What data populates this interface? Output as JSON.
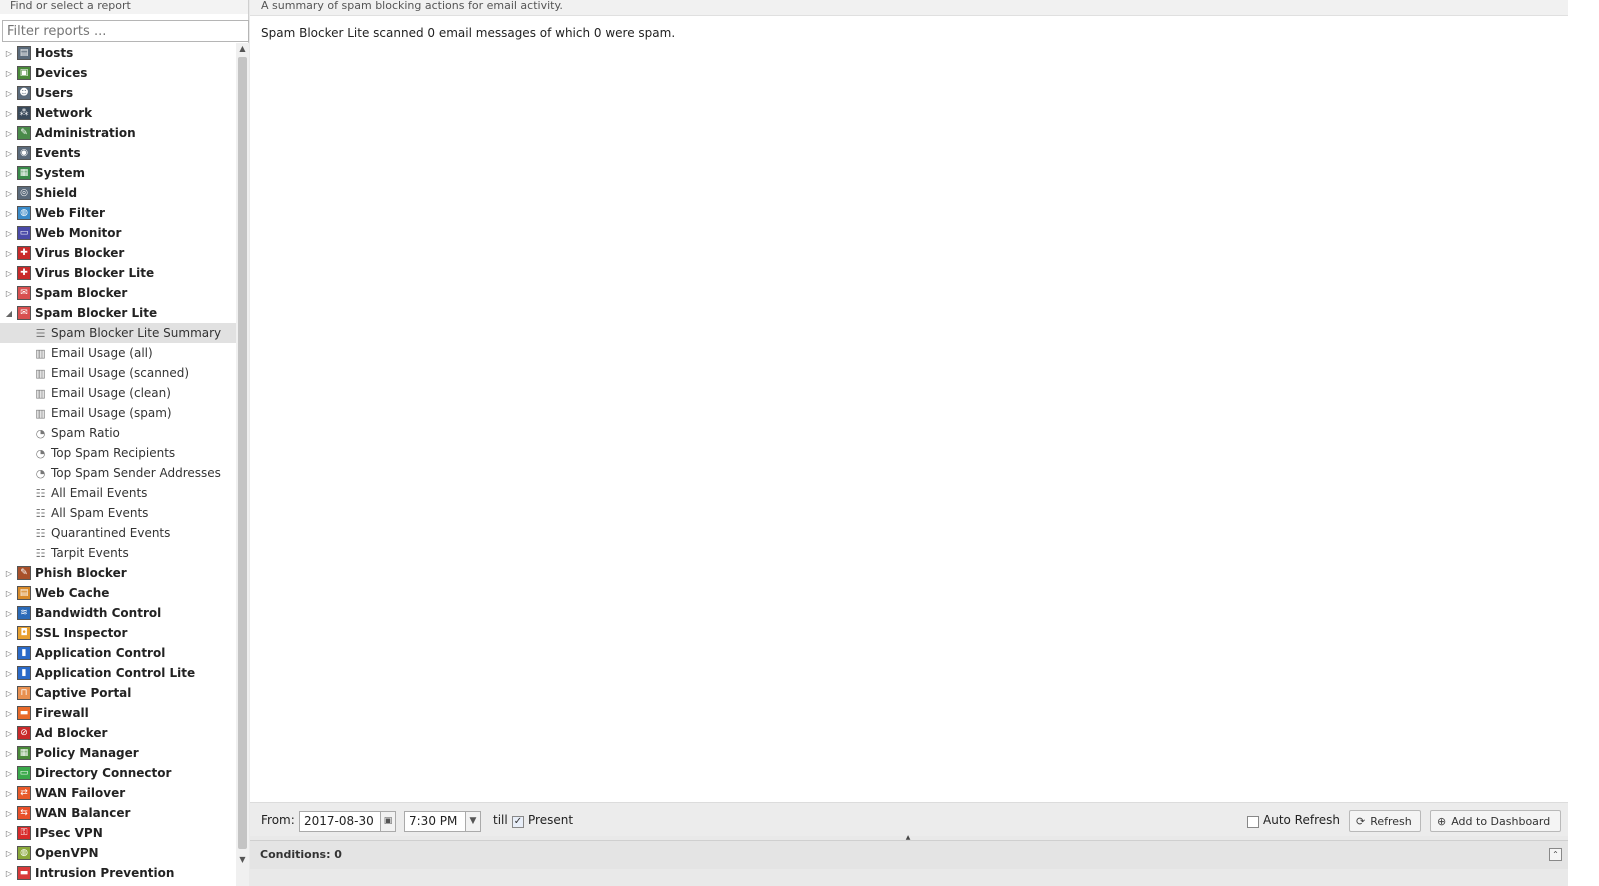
{
  "left": {
    "header": "Find or select a report",
    "filter_placeholder": "Filter reports ...",
    "categories": [
      {
        "label": "Hosts",
        "icon": "hosts-icon",
        "color": "#5a6a7a",
        "glyph": "▤"
      },
      {
        "label": "Devices",
        "icon": "devices-icon",
        "color": "#4a8a3a",
        "glyph": "▣"
      },
      {
        "label": "Users",
        "icon": "users-icon",
        "color": "#5a6a7a",
        "glyph": "☻"
      },
      {
        "label": "Network",
        "icon": "network-icon",
        "color": "#3a4a5a",
        "glyph": "⁂"
      },
      {
        "label": "Administration",
        "icon": "administration-icon",
        "color": "#4a8a4a",
        "glyph": "✎"
      },
      {
        "label": "Events",
        "icon": "events-icon",
        "color": "#5a6a7a",
        "glyph": "◉"
      },
      {
        "label": "System",
        "icon": "system-icon",
        "color": "#3a8a4a",
        "glyph": "▦"
      },
      {
        "label": "Shield",
        "icon": "shield-icon",
        "color": "#5a6a7a",
        "glyph": "◎"
      },
      {
        "label": "Web Filter",
        "icon": "web-filter-icon",
        "color": "#3a8ac8",
        "glyph": "◍"
      },
      {
        "label": "Web Monitor",
        "icon": "web-monitor-icon",
        "color": "#4a4aa8",
        "glyph": "▭"
      },
      {
        "label": "Virus Blocker",
        "icon": "virus-blocker-icon",
        "color": "#c82a2a",
        "glyph": "✚"
      },
      {
        "label": "Virus Blocker Lite",
        "icon": "virus-blocker-lite-icon",
        "color": "#c82a2a",
        "glyph": "✚"
      }
    ],
    "spam_blocker": {
      "label": "Spam Blocker",
      "icon": "spam-blocker-icon",
      "color": "#d85050",
      "glyph": "✉"
    },
    "expanded": {
      "label": "Spam Blocker Lite",
      "icon": "spam-blocker-lite-icon",
      "color": "#d85050",
      "glyph": "✉",
      "items": [
        {
          "label": "Spam Blocker Lite Summary",
          "icon": "text-report-icon",
          "glyph": "☰",
          "selected": true
        },
        {
          "label": "Email Usage (all)",
          "icon": "bar-chart-icon",
          "glyph": "▥",
          "selected": false
        },
        {
          "label": "Email Usage (scanned)",
          "icon": "bar-chart-icon",
          "glyph": "▥",
          "selected": false
        },
        {
          "label": "Email Usage (clean)",
          "icon": "bar-chart-icon",
          "glyph": "▥",
          "selected": false
        },
        {
          "label": "Email Usage (spam)",
          "icon": "bar-chart-icon",
          "glyph": "▥",
          "selected": false
        },
        {
          "label": "Spam Ratio",
          "icon": "pie-chart-icon",
          "glyph": "◔",
          "selected": false
        },
        {
          "label": "Top Spam Recipients",
          "icon": "pie-chart-icon",
          "glyph": "◔",
          "selected": false
        },
        {
          "label": "Top Spam Sender Addresses",
          "icon": "pie-chart-icon",
          "glyph": "◔",
          "selected": false
        },
        {
          "label": "All Email Events",
          "icon": "event-list-icon",
          "glyph": "☷",
          "selected": false
        },
        {
          "label": "All Spam Events",
          "icon": "event-list-icon",
          "glyph": "☷",
          "selected": false
        },
        {
          "label": "Quarantined Events",
          "icon": "event-list-icon",
          "glyph": "☷",
          "selected": false
        },
        {
          "label": "Tarpit Events",
          "icon": "event-list-icon",
          "glyph": "☷",
          "selected": false
        }
      ]
    },
    "categories_after": [
      {
        "label": "Phish Blocker",
        "icon": "phish-blocker-icon",
        "color": "#a8502a",
        "glyph": "✎"
      },
      {
        "label": "Web Cache",
        "icon": "web-cache-icon",
        "color": "#d88a2a",
        "glyph": "▤"
      },
      {
        "label": "Bandwidth Control",
        "icon": "bandwidth-control-icon",
        "color": "#2a6ab8",
        "glyph": "≋"
      },
      {
        "label": "SSL Inspector",
        "icon": "ssl-inspector-icon",
        "color": "#e8a030",
        "glyph": "◘"
      },
      {
        "label": "Application Control",
        "icon": "application-control-icon",
        "color": "#2a6ac8",
        "glyph": "▮"
      },
      {
        "label": "Application Control Lite",
        "icon": "application-control-lite-icon",
        "color": "#2a6ac8",
        "glyph": "▮"
      },
      {
        "label": "Captive Portal",
        "icon": "captive-portal-icon",
        "color": "#e89050",
        "glyph": "⊓"
      },
      {
        "label": "Firewall",
        "icon": "firewall-icon",
        "color": "#e86a2a",
        "glyph": "▬"
      },
      {
        "label": "Ad Blocker",
        "icon": "ad-blocker-icon",
        "color": "#c82a2a",
        "glyph": "⊘"
      },
      {
        "label": "Policy Manager",
        "icon": "policy-manager-icon",
        "color": "#4a8a3a",
        "glyph": "▦"
      },
      {
        "label": "Directory Connector",
        "icon": "directory-connector-icon",
        "color": "#3aa84a",
        "glyph": "▭"
      },
      {
        "label": "WAN Failover",
        "icon": "wan-failover-icon",
        "color": "#e85a2a",
        "glyph": "⇄"
      },
      {
        "label": "WAN Balancer",
        "icon": "wan-balancer-icon",
        "color": "#e8502a",
        "glyph": "⇆"
      },
      {
        "label": "IPsec VPN",
        "icon": "ipsec-vpn-icon",
        "color": "#d82a2a",
        "glyph": "⚿"
      },
      {
        "label": "OpenVPN",
        "icon": "openvpn-icon",
        "color": "#8aa83a",
        "glyph": "◍"
      },
      {
        "label": "Intrusion Prevention",
        "icon": "intrusion-prevention-icon",
        "color": "#d83a3a",
        "glyph": "▬"
      }
    ]
  },
  "main": {
    "description": "A summary of spam blocking actions for email activity.",
    "summary_text": "Spam Blocker Lite scanned 0 email messages of which 0 were spam."
  },
  "toolbar": {
    "from_label": "From:",
    "date_value": "2017-08-30",
    "time_value": "7:30 PM",
    "till_label": "till",
    "present_label": "Present",
    "present_checked": true,
    "auto_refresh_label": "Auto Refresh",
    "auto_refresh_checked": false,
    "refresh_label": "Refresh",
    "add_dashboard_label": "Add to Dashboard"
  },
  "conditions": {
    "title": "Conditions: 0"
  }
}
